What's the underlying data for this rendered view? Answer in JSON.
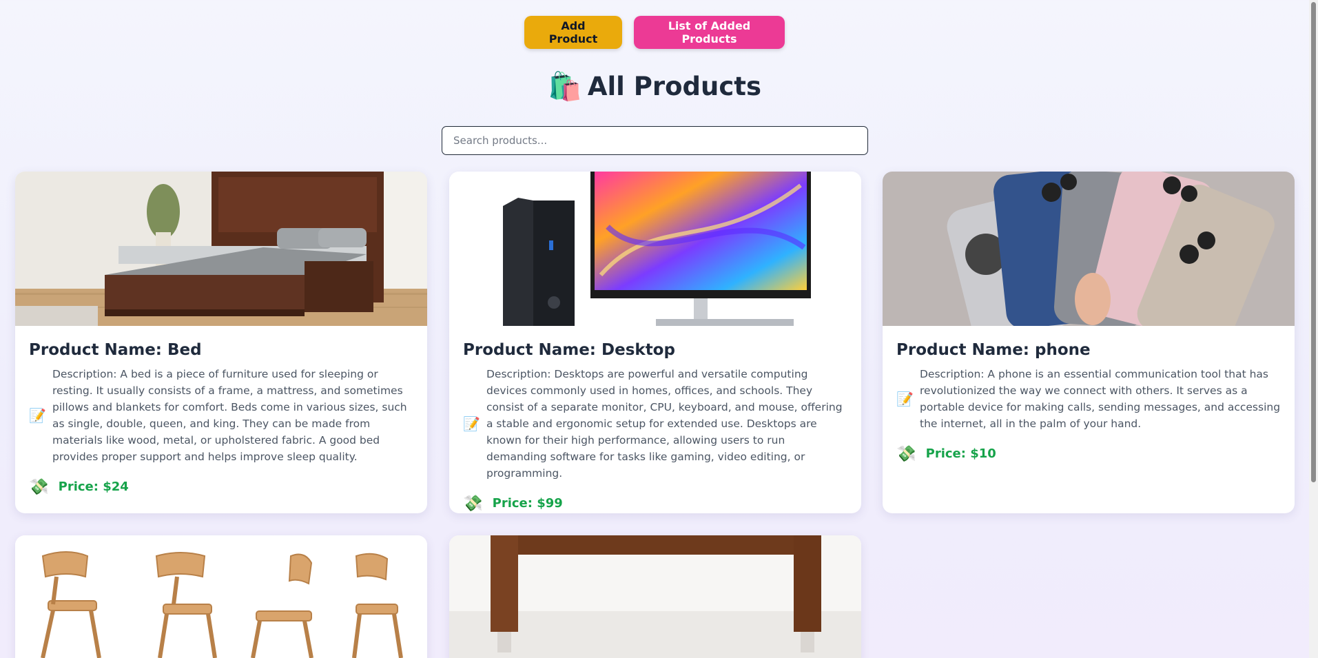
{
  "nav": {
    "add_label": "Add Product",
    "list_label": "List of Added Products"
  },
  "heading": {
    "icon": "🛍️",
    "title": "All Products"
  },
  "search": {
    "placeholder": "Search products...",
    "value": ""
  },
  "products": [
    {
      "name": "Product Name: Bed",
      "description": "Description: A bed is a piece of furniture used for sleeping or resting. It usually consists of a frame, a mattress, and sometimes pillows and blankets for comfort. Beds come in various sizes, such as single, double, queen, and king. They can be made from materials like wood, metal, or upholstered fabric. A good bed provides proper support and helps improve sleep quality.",
      "price": "Price: $24",
      "desc_icon": "📝",
      "price_icon": "💸"
    },
    {
      "name": "Product Name: Desktop",
      "description": "Description: Desktops are powerful and versatile computing devices commonly used in homes, offices, and schools. They consist of a separate monitor, CPU, keyboard, and mouse, offering a stable and ergonomic setup for extended use. Desktops are known for their high performance, allowing users to run demanding software for tasks like gaming, video editing, or programming.",
      "price": "Price: $99",
      "desc_icon": "📝",
      "price_icon": "💸"
    },
    {
      "name": "Product Name: phone",
      "description": "Description: A phone is an essential communication tool that has revolutionized the way we connect with others. It serves as a portable device for making calls, sending messages, and accessing the internet, all in the palm of your hand.",
      "price": "Price: $10",
      "desc_icon": "📝",
      "price_icon": "💸"
    }
  ],
  "colors": {
    "add_button": "#eaaa0c",
    "list_button": "#ec3a95",
    "price": "#16a34a"
  }
}
